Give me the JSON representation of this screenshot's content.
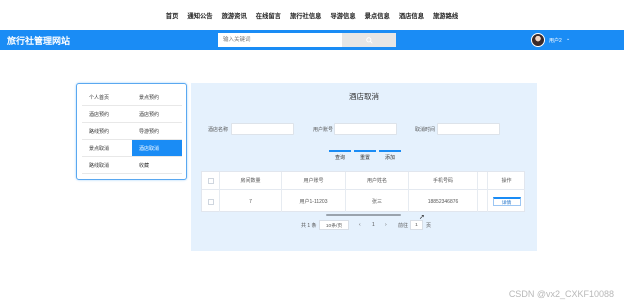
{
  "topnav": {
    "items": [
      "首页",
      "通知公告",
      "旅游资讯",
      "在线留言",
      "旅行社信息",
      "导游信息",
      "景点信息",
      "酒店信息",
      "旅游路线"
    ]
  },
  "header": {
    "site_title": "旅行社管理网站",
    "search_placeholder": "输入关键词",
    "search_button_icon": "search-icon",
    "user_name": "用户2",
    "user_caret": "⌄",
    "brand_color": "#1a8cf5"
  },
  "sidemenu": {
    "items": [
      {
        "label": "个人首页",
        "active": false
      },
      {
        "label": "景点预约",
        "active": false
      },
      {
        "label": "酒店预约",
        "active": false
      },
      {
        "label": "酒店预约",
        "active": false
      },
      {
        "label": "路线预约",
        "active": false
      },
      {
        "label": "导游预约",
        "active": false
      },
      {
        "label": "景点取消",
        "active": false
      },
      {
        "label": "酒店取消",
        "active": true
      },
      {
        "label": "路线取消",
        "active": false
      },
      {
        "label": "收藏",
        "active": false
      }
    ]
  },
  "main": {
    "title": "酒店取消",
    "filters": [
      {
        "label": "酒店名称",
        "value": ""
      },
      {
        "label": "用户账号",
        "value": ""
      },
      {
        "label": "取消时间",
        "value": ""
      }
    ],
    "buttons": {
      "search": "查询",
      "reset": "重置",
      "add": "添加"
    },
    "table": {
      "headers": [
        "",
        "房间数量",
        "用户账号",
        "用户姓名",
        "手机号码",
        "",
        "操作"
      ],
      "rows": [
        {
          "checked": false,
          "rooms": "7",
          "account": "用户1-11203",
          "name": "张三",
          "phone": "18852346876",
          "extra": "",
          "action": "详情"
        }
      ]
    },
    "pagination": {
      "total_text": "共 1 条",
      "page_size": "10条/页",
      "prev": "‹",
      "current": "1",
      "next": "›",
      "goto_label": "前往",
      "goto_value": "1",
      "page_suffix": "页"
    }
  },
  "watermark": "CSDN @vx2_CXKF10088"
}
